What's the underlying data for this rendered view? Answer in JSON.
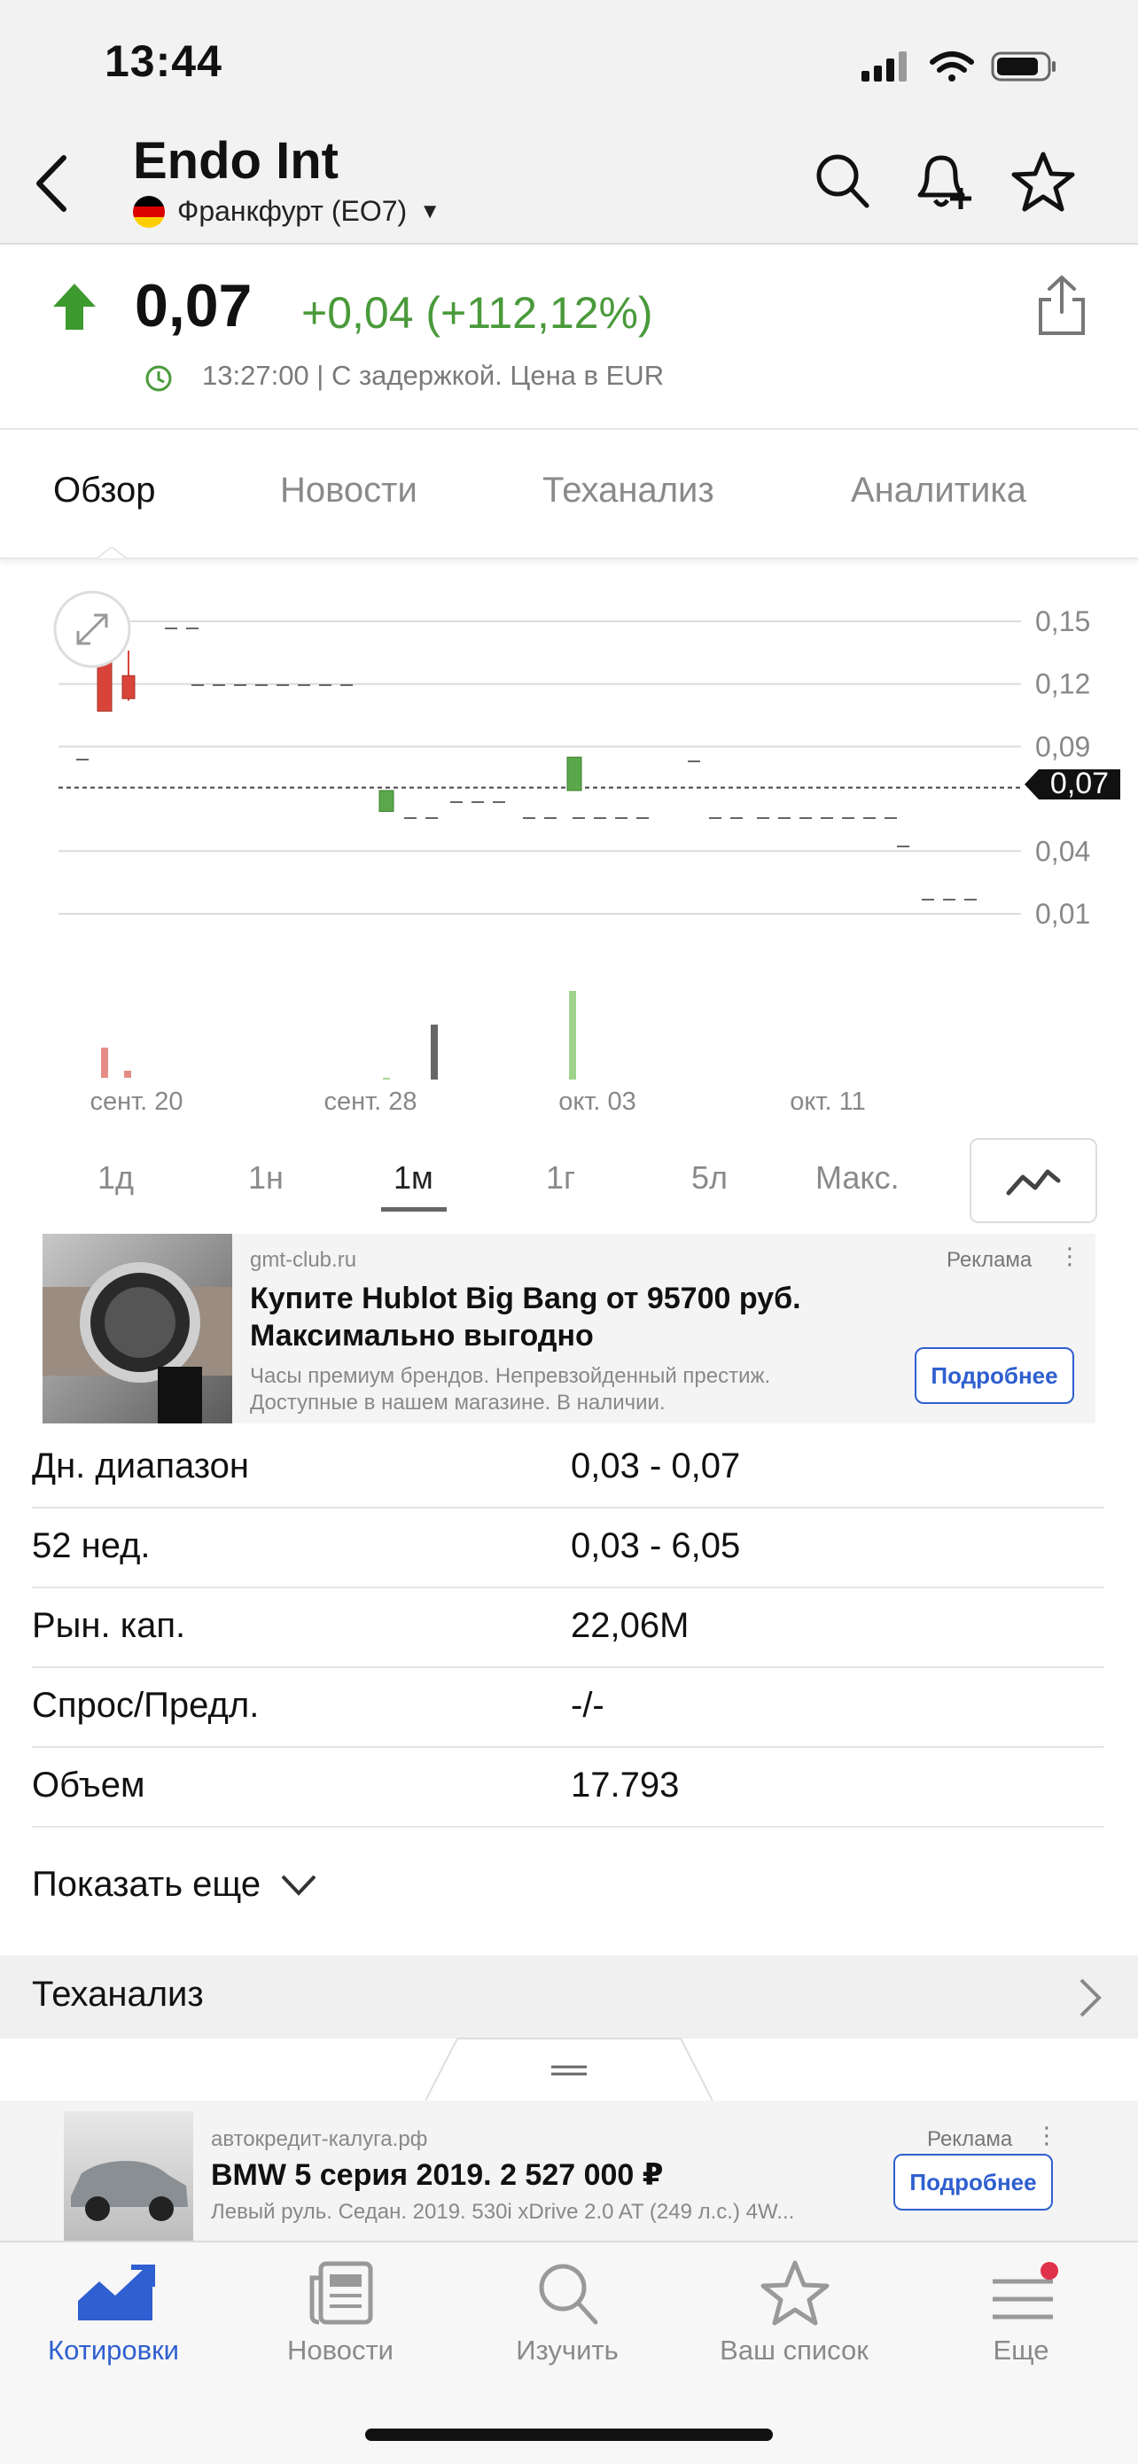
{
  "status_bar": {
    "time": "13:44"
  },
  "header": {
    "title": "Endo Int",
    "exchange": "Франкфурт (EO7)"
  },
  "quote": {
    "price": "0,07",
    "change": "+0,04 (+112,12%)",
    "meta": "13:27:00 | С задержкой. Цена в EUR"
  },
  "tabs": [
    {
      "label": "Обзор"
    },
    {
      "label": "Новости"
    },
    {
      "label": "Теханализ"
    },
    {
      "label": "Аналитика"
    }
  ],
  "chart_data": {
    "type": "candlestick",
    "y_ticks": [
      "0,15",
      "0,12",
      "0,09",
      "0,04",
      "0,01"
    ],
    "x_ticks": [
      "сент. 20",
      "сент. 28",
      "окт. 03",
      "окт. 11"
    ],
    "current_label": "0,07",
    "current": 0.07,
    "ylim": [
      0.0,
      0.16
    ],
    "candles": [
      {
        "o": 0.141,
        "h": 0.15,
        "l": 0.107,
        "c": 0.107,
        "up": false
      },
      {
        "o": 0.124,
        "h": 0.136,
        "l": 0.112,
        "c": 0.113,
        "up": false
      },
      {
        "o": 0.059,
        "h": 0.069,
        "l": 0.059,
        "c": 0.069,
        "up": true
      },
      {
        "o": 0.069,
        "h": 0.085,
        "l": 0.069,
        "c": 0.085,
        "up": true
      }
    ],
    "colors": {
      "up": "#5aa84a",
      "down": "#d9443a"
    }
  },
  "ranges": [
    {
      "label": "1д"
    },
    {
      "label": "1н"
    },
    {
      "label": "1м"
    },
    {
      "label": "1г"
    },
    {
      "label": "5л"
    },
    {
      "label": "Макс."
    }
  ],
  "ad1": {
    "domain": "gmt-club.ru",
    "badge": "Реклама",
    "title": "Купите Hublot Big Bang от 95700 руб. Максимально выгодно",
    "desc1": "Часы премиум брендов. Непревзойденный престиж.",
    "desc2": "Доступные в нашем магазине. В наличии.",
    "button": "Подробнее"
  },
  "stats": [
    {
      "label": "Дн. диапазон",
      "value": "0,03 - 0,07"
    },
    {
      "label": "52 нед.",
      "value": "0,03 - 6,05"
    },
    {
      "label": "Рын. кап.",
      "value": "22,06M"
    },
    {
      "label": "Спрос/Предл.",
      "value": "-/-"
    },
    {
      "label": "Объем",
      "value": "17.793"
    }
  ],
  "show_more": "Показать еще",
  "section_title": "Теханализ",
  "ad2": {
    "domain": "автокредит-калуга.рф",
    "badge": "Реклама",
    "title": "BMW 5 серия 2019. 2 527 000 ₽",
    "desc": "Левый руль. Седан. 2019. 530i xDrive 2.0 AT (249 л.с.) 4W...",
    "button": "Подробнее"
  },
  "bottom_nav": [
    {
      "label": "Котировки",
      "icon": "chart-icon",
      "active": true
    },
    {
      "label": "Новости",
      "icon": "news-icon",
      "active": false
    },
    {
      "label": "Изучить",
      "icon": "search-icon",
      "active": false
    },
    {
      "label": "Ваш список",
      "icon": "star-icon",
      "active": false
    },
    {
      "label": "Еще",
      "icon": "menu-icon",
      "active": false
    }
  ],
  "colors": {
    "positive": "#4a9a3b",
    "accent": "#2f5fd0",
    "badge": "#e0314b"
  }
}
